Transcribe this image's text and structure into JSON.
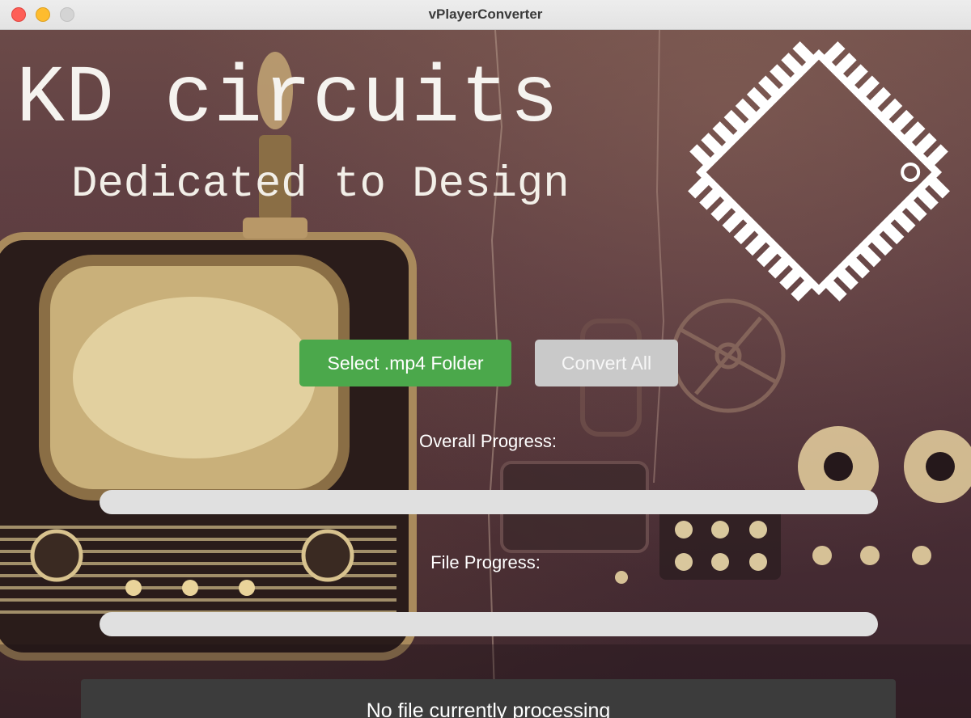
{
  "window": {
    "title": "vPlayerConverter"
  },
  "branding": {
    "title": "KD circuits",
    "subtitle": "Dedicated to Design"
  },
  "buttons": {
    "select_folder": "Select .mp4 Folder",
    "convert_all": "Convert All"
  },
  "progress": {
    "overall_label": "Overall Progress:",
    "overall_value": 0,
    "file_label": "File Progress:",
    "file_value": 0
  },
  "status": {
    "text": "No file currently processing"
  },
  "colors": {
    "primary_button": "#4ba84b",
    "disabled_button": "#c9c9c9",
    "progress_track": "#e0e0e0",
    "status_panel": "#3c3c3c"
  },
  "icons": {
    "chip_logo": "ic-chip-icon"
  }
}
